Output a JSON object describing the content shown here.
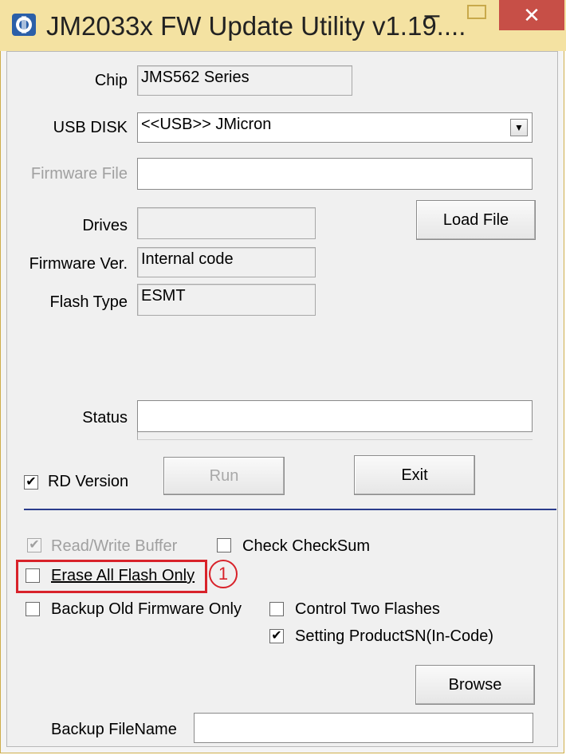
{
  "window": {
    "title": "JM2033x FW Update Utility v1.19....",
    "minimize_glyph": "–",
    "close_glyph": "✕",
    "app_icon": "jmicron-app-icon"
  },
  "form": {
    "chip": {
      "label": "Chip",
      "value": "JMS562 Series"
    },
    "usb_disk": {
      "label": "USB DISK",
      "value": "<<USB>> JMicron"
    },
    "firmware_file": {
      "label": "Firmware File",
      "value": ""
    },
    "drives": {
      "label": "Drives",
      "value": ""
    },
    "firmware_ver": {
      "label": "Firmware Ver.",
      "value": "Internal code"
    },
    "flash_type": {
      "label": "Flash Type",
      "value": "ESMT"
    },
    "status": {
      "label": "Status",
      "value": ""
    },
    "load_file_button": "Load File",
    "rd_version": {
      "label": "RD Version",
      "checked": true
    },
    "run_button": "Run",
    "exit_button": "Exit"
  },
  "options": {
    "read_write_buffer": {
      "label": "Read/Write Buffer",
      "checked": true,
      "disabled": true
    },
    "check_checksum": {
      "label": "Check CheckSum",
      "checked": false
    },
    "erase_all_flash_only": {
      "label": "Erase All Flash Only",
      "checked": false
    },
    "backup_old_firmware_only": {
      "label": "Backup Old Firmware Only",
      "checked": false
    },
    "control_two_flashes": {
      "label": "Control Two Flashes",
      "checked": false
    },
    "setting_product_sn": {
      "label": "Setting ProductSN(In-Code)",
      "checked": true
    },
    "browse_button": "Browse",
    "backup_filename": {
      "label": "Backup FileName",
      "value": ""
    }
  },
  "annotation": {
    "marker": "1"
  },
  "check_glyph": "✔",
  "dropdown_glyph": "▼"
}
